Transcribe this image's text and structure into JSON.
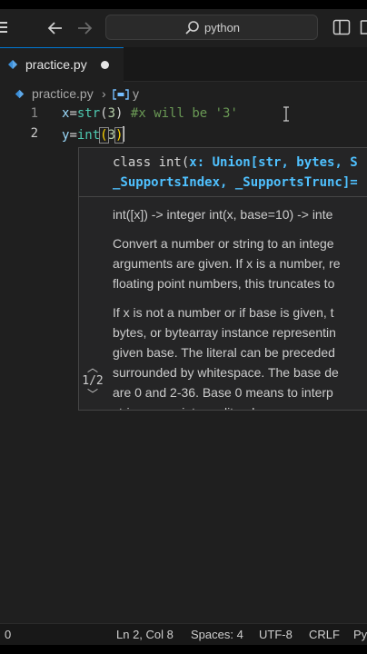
{
  "titlebar": {
    "search_text": "python"
  },
  "tab": {
    "filename": "practice.py"
  },
  "breadcrumb": {
    "file": "practice.py",
    "symbol": "y"
  },
  "editor": {
    "lines": [
      {
        "number": "1",
        "var": "x",
        "eq": "=",
        "func": "str",
        "open": "(",
        "arg": "3",
        "close": ")",
        "comment": " #x will be '3'"
      },
      {
        "number": "2",
        "var": "y",
        "eq": "=",
        "func": "int",
        "open": "(",
        "arg": "3",
        "close": ")"
      }
    ]
  },
  "hover": {
    "sig_line1_prefix": "class int(",
    "sig_line1_param": "x: Union[str, bytes, S",
    "sig_line2_param": "_SupportsIndex, _SupportsTrunc]=",
    "doc_lines": [
      "int([x]) -> integer int(x, base=10) -> inte",
      "Convert a number or string to an intege",
      "arguments are given. If x is a number, re",
      "floating point numbers, this truncates to",
      "If x is not a number or if base is given, t",
      "bytes, or bytearray instance representin",
      "given base. The literal can be preceded",
      "surrounded by whitespace. The base de",
      "are 0 and 2-36. Base 0 means to interp",
      "string as an integer literal"
    ],
    "pager": "1/2"
  },
  "status": {
    "errors": "0",
    "position": "Ln 2, Col 8",
    "spaces": "Spaces: 4",
    "encoding": "UTF-8",
    "eol": "CRLF",
    "language": "Py"
  },
  "colors": {
    "accent": "#0078d4",
    "editor_bg": "#1f1f1f",
    "hover_bg": "#252526"
  }
}
